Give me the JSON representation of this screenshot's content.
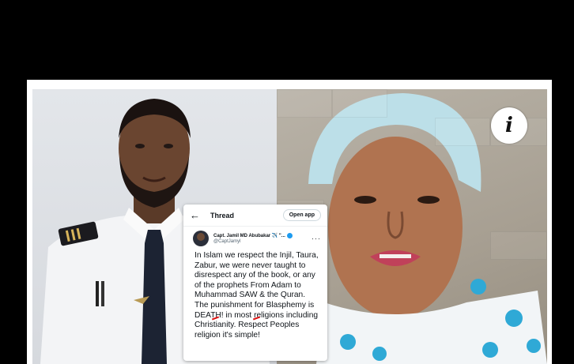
{
  "tweet_card": {
    "header": {
      "back_icon": "arrow-left-icon",
      "title": "Thread",
      "open_app": "Open app"
    },
    "author": {
      "name": "Capt. Jamil MD Abubakar ✈️ \"...",
      "handle": "@CaptJamyl",
      "verified": true
    },
    "body": "In Islam we respect the Injil, Taura, Zabur, we were never taught to disrespect any of the book, or any of the prophets From Adam to Muhammad SAW & the Quran. The punishment for Blasphemy is DEATH! in most religions including Christianity. Respect Peoples religion it's simple!"
  },
  "overlay": {
    "info_symbol": "i"
  },
  "colors": {
    "verified": "#1d9bf0",
    "background": "#000000",
    "frame": "#ffffff"
  }
}
